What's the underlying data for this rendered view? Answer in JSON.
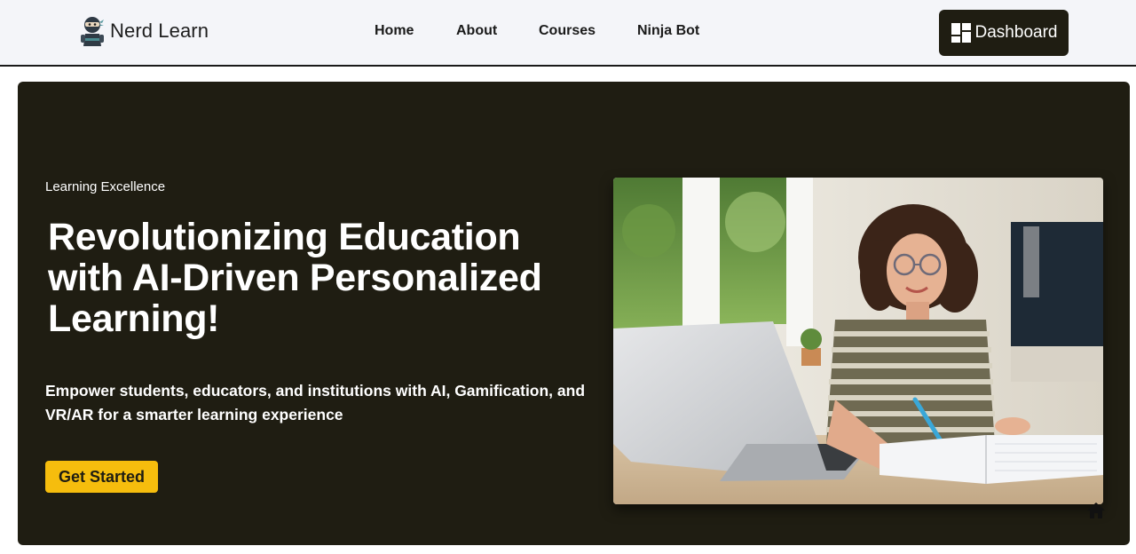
{
  "navbar": {
    "brand_name": "Nerd Learn",
    "links": [
      "Home",
      "About",
      "Courses",
      "Ninja Bot"
    ],
    "dashboard_label": "Dashboard"
  },
  "hero": {
    "eyebrow": "Learning Excellence",
    "title": "Revolutionizing Education with AI-Driven Personalized Learning!",
    "subtitle": "Empower students, educators, and institutions with AI, Gamification, and VR/AR for a smarter learning experience",
    "cta_label": "Get Started"
  },
  "icons": {
    "brand": "ninja-logo-icon",
    "dashboard": "grid-icon",
    "floating": "home-icon"
  },
  "colors": {
    "hero_bg": "#1f1d12",
    "accent": "#f6bd0d",
    "nav_bg": "#f4f5f9"
  }
}
